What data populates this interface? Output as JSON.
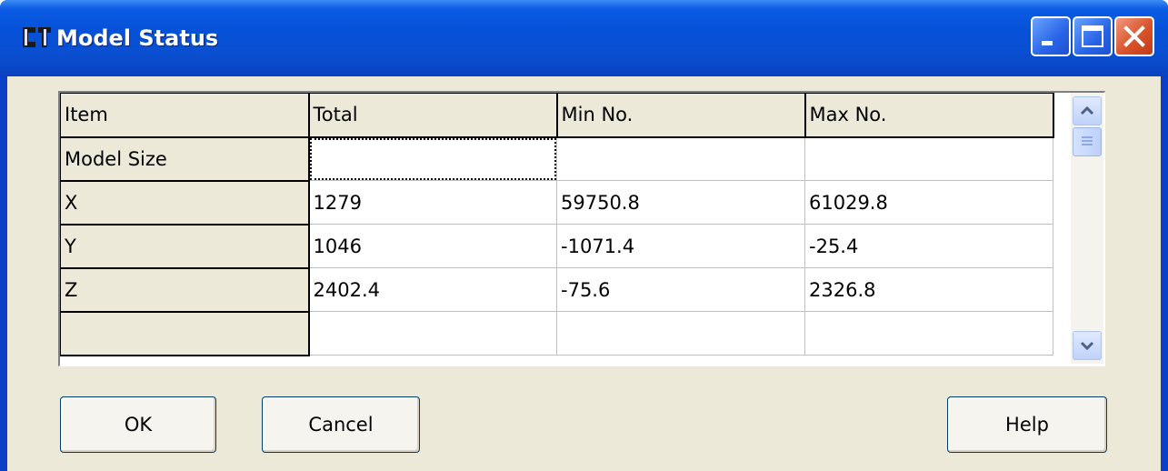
{
  "window": {
    "title": "Model Status",
    "app_icon": "cf-logo-icon",
    "controls": [
      "minimize-icon",
      "maximize-icon",
      "close-icon"
    ]
  },
  "grid": {
    "headers": [
      "Item",
      "Total",
      "Min No.",
      "Max No."
    ],
    "rows": [
      {
        "item": "Model Size",
        "total": "",
        "min": "",
        "max": ""
      },
      {
        "item": "X",
        "total": "1279",
        "min": "59750.8",
        "max": "61029.8"
      },
      {
        "item": "Y",
        "total": "1046",
        "min": "-1071.4",
        "max": "-25.4"
      },
      {
        "item": "Z",
        "total": "2402.4",
        "min": "-75.6",
        "max": "2326.8"
      },
      {
        "item": "",
        "total": "",
        "min": "",
        "max": ""
      }
    ]
  },
  "buttons": {
    "ok": "OK",
    "cancel": "Cancel",
    "help": "Help"
  }
}
